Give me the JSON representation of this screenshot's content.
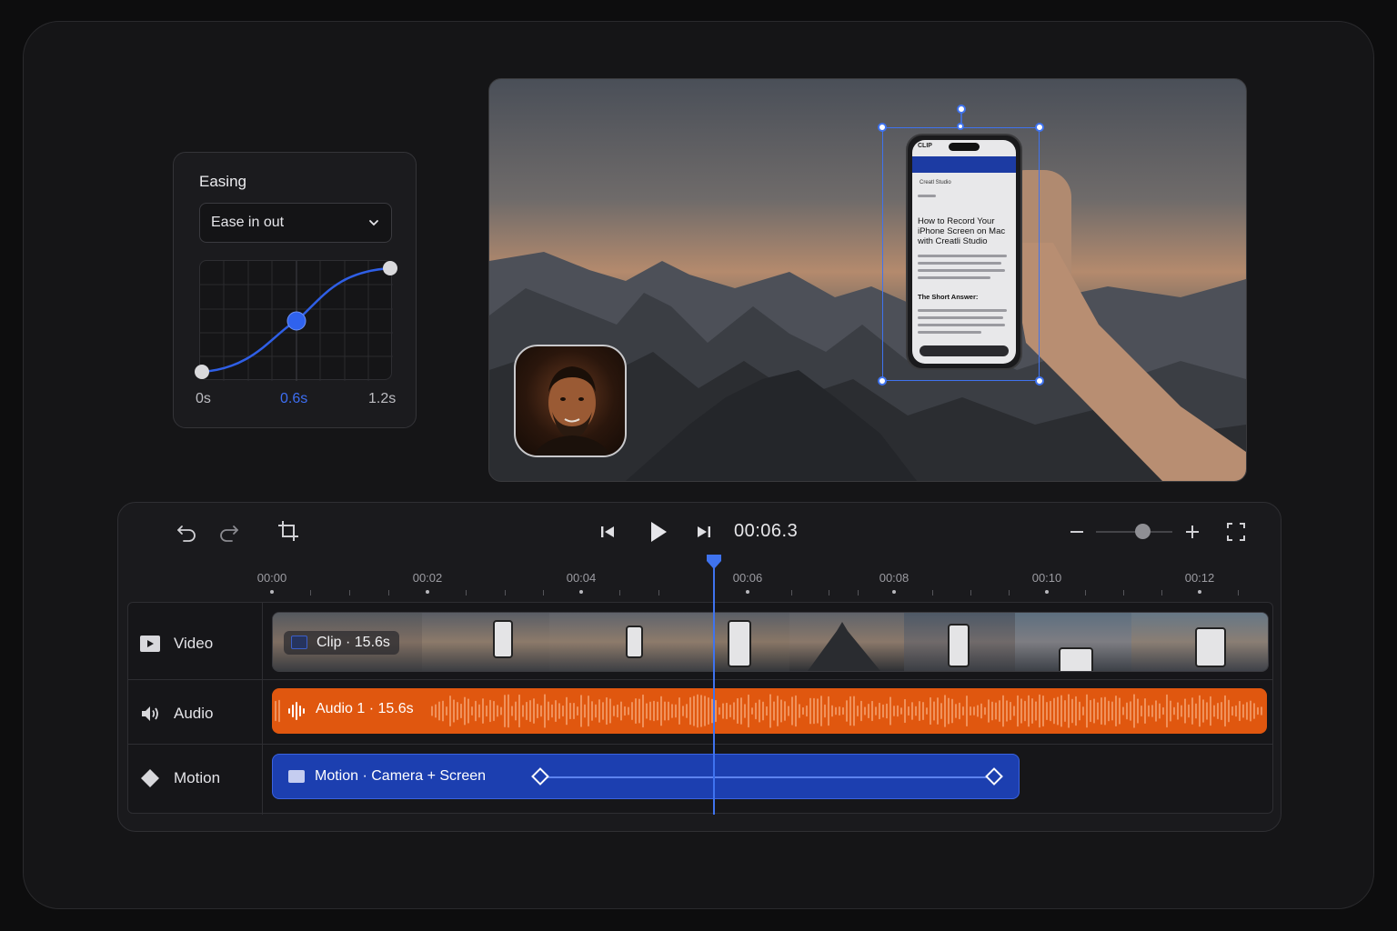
{
  "easing": {
    "title": "Easing",
    "selected": "Ease in out",
    "ticks": [
      "0s",
      "0.6s",
      "1.2s"
    ]
  },
  "timeline": {
    "timecode": "00:06.3",
    "zoom_level": 0.62,
    "ruler": [
      "00:00",
      "00:02",
      "00:04",
      "00:06",
      "00:08",
      "00:10",
      "00:12"
    ],
    "tracks": {
      "video": {
        "label": "Video",
        "clip": "Clip · 15.6s"
      },
      "audio": {
        "label": "Audio",
        "clip": "Audio 1 · 15.6s"
      },
      "motion": {
        "label": "Motion",
        "clip": "Motion · Camera + Screen"
      }
    }
  },
  "phone": {
    "status": "CLIP",
    "app": "Creatl Studio",
    "headline": "How to Record Your iPhone Screen on Mac with Creatli Studio",
    "sub": "The Short Answer:"
  },
  "colors": {
    "accent": "#3f73ef",
    "audio": "#e0570f",
    "motion": "#1c3fb0"
  }
}
